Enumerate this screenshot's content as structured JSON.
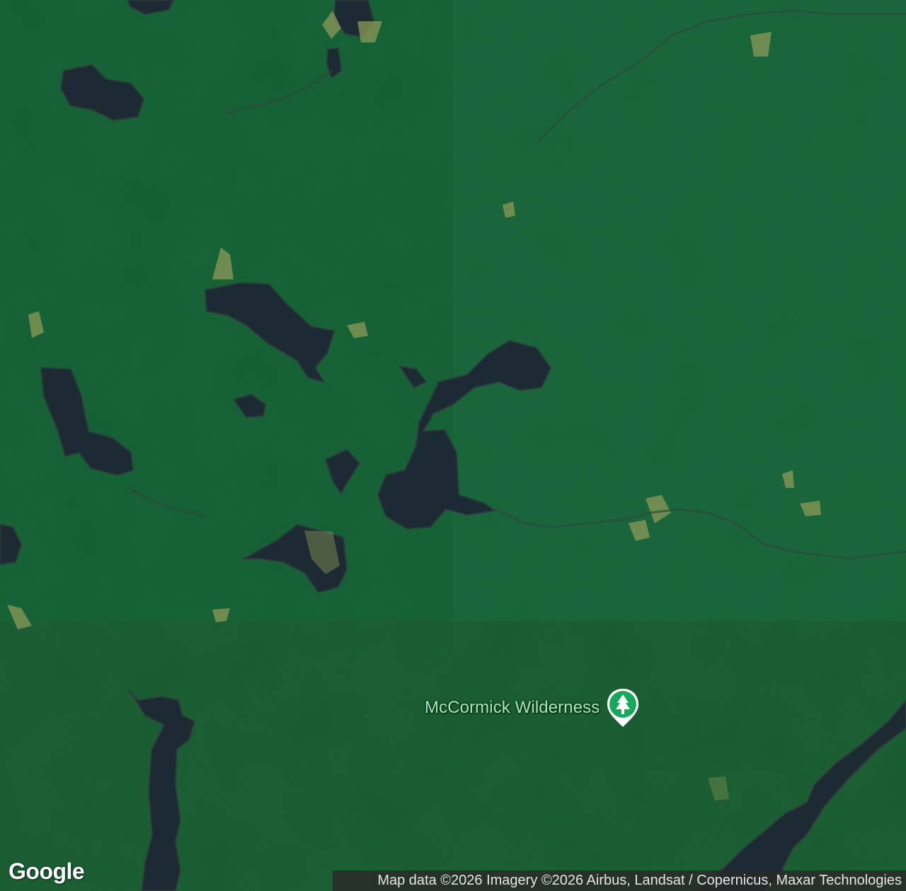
{
  "map": {
    "type": "satellite",
    "colors": {
      "forest_upper": "#1d5a30",
      "forest_lower": "#24522b",
      "water": "#1a2530",
      "marsh": "#8a9a55",
      "pin": "#17a85c"
    }
  },
  "poi": {
    "label": "McCormick Wilderness",
    "icon": "tree-park-pin-icon"
  },
  "branding": {
    "logo_text": "Google"
  },
  "attribution": {
    "text": "Map data ©2026 Imagery ©2026 Airbus, Landsat / Copernicus, Maxar Technologies"
  }
}
